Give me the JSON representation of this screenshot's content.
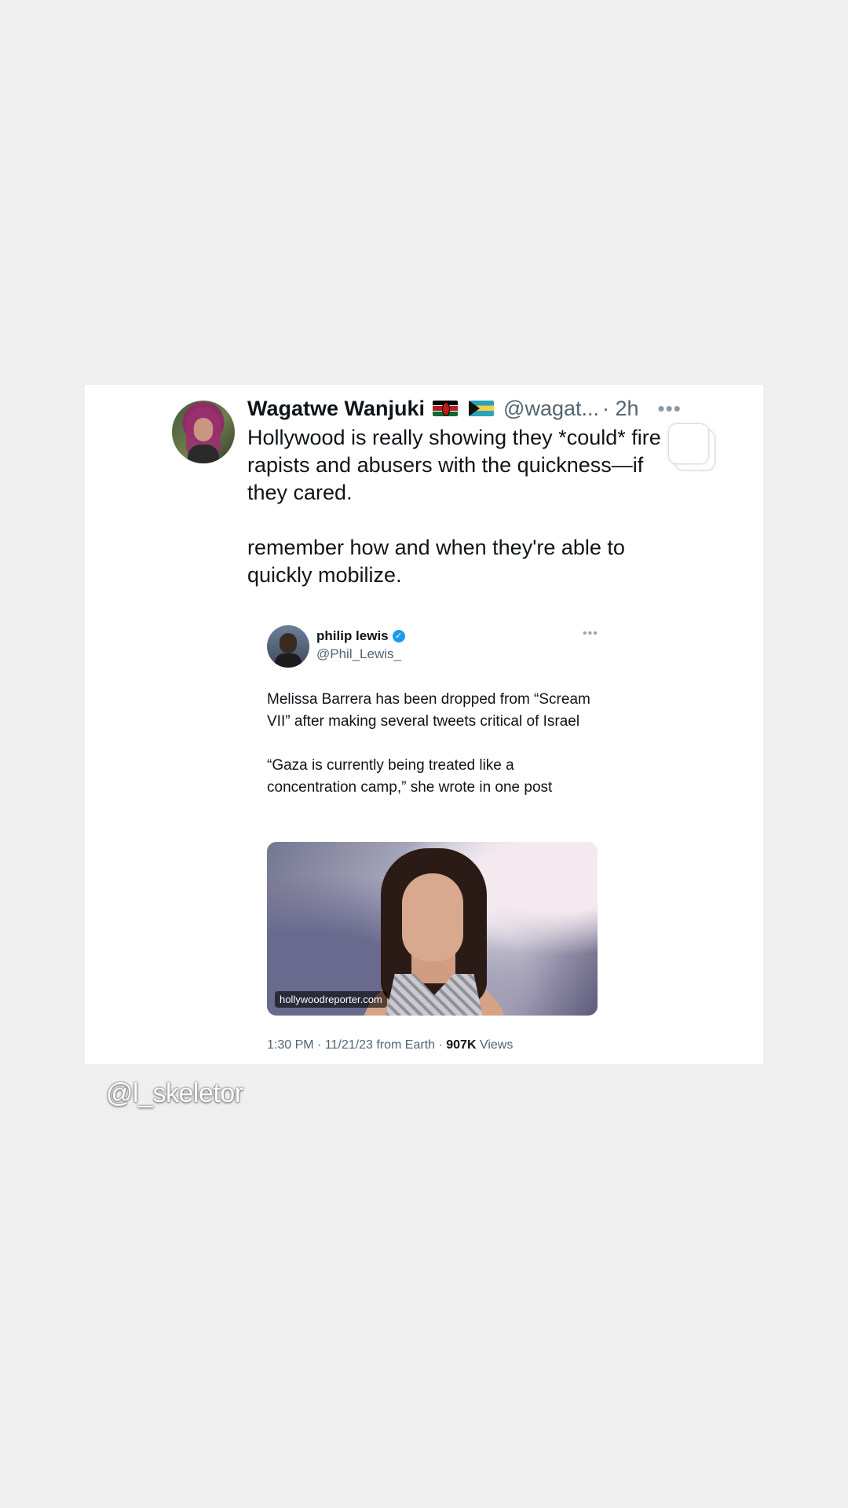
{
  "tweet": {
    "author_name": "Wagatwe Wanjuki",
    "flags": [
      "kenya-flag",
      "bahamas-flag"
    ],
    "handle": "@wagat...",
    "time": "· 2h",
    "more": "•••",
    "text": "Hollywood is really showing they *could* fire rapists and abusers with the quickness—if they cared.\n\nremember how and when they're able to quickly mobilize."
  },
  "quoted": {
    "author_name": "philip lewis",
    "verified_glyph": "✓",
    "handle": "@Phil_Lewis_",
    "more": "•••",
    "text": "Melissa Barrera has been dropped from “Scream VII” after making several tweets critical of Israel\n\n“Gaza is currently being treated like a concentration camp,” she wrote in one post",
    "image_source": "hollywoodreporter.com",
    "meta_prefix": "1:30 PM · 11/21/23 from Earth · ",
    "views_count": "907K",
    "views_label": " Views"
  },
  "watermark": "@l_skeletor",
  "colors": {
    "background": "#efeff0",
    "card": "#ffffff",
    "text": "#0f1419",
    "secondary": "#536471",
    "verified": "#1d9bf0"
  }
}
